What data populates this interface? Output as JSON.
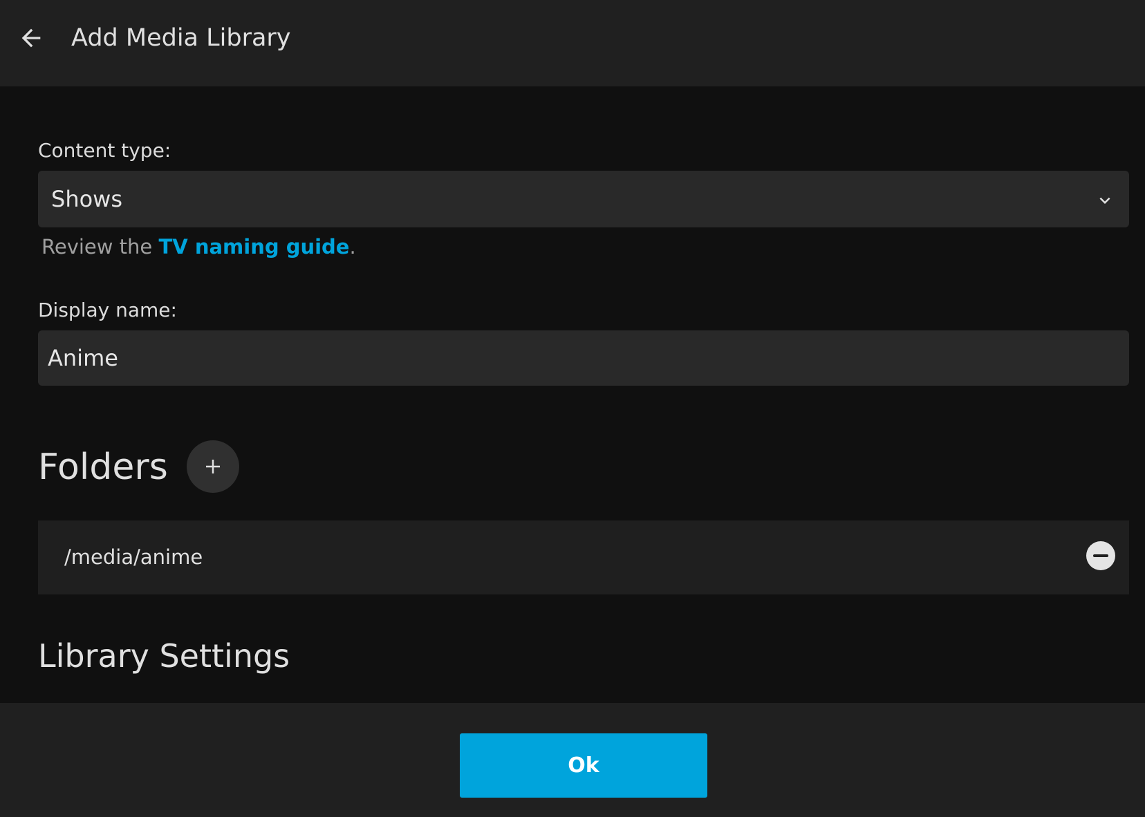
{
  "header": {
    "back_icon": "arrow-left-icon",
    "title": "Add Media Library"
  },
  "content_type": {
    "label": "Content type:",
    "value": "Shows",
    "icon": "chevron-down-icon"
  },
  "help": {
    "prefix": "Review the ",
    "link_text": "TV naming guide",
    "suffix": "."
  },
  "display_name": {
    "label": "Display name:",
    "value": "Anime"
  },
  "folders": {
    "title": "Folders",
    "add_icon": "plus-icon",
    "items": [
      {
        "path": "/media/anime",
        "remove_icon": "minus-circle-icon"
      }
    ]
  },
  "library_settings": {
    "title": "Library Settings"
  },
  "footer": {
    "ok_label": "Ok"
  },
  "colors": {
    "background": "#101010",
    "panel": "#202020",
    "input": "#292929",
    "accent": "#00a4dc"
  }
}
